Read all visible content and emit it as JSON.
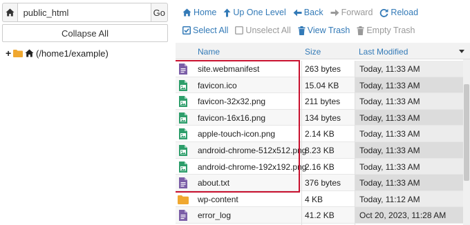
{
  "left_pane": {
    "path_value": "public_html",
    "go_label": "Go",
    "collapse_label": "Collapse All",
    "tree_root_label": "(/home1/example)"
  },
  "toolbar": {
    "row1": [
      {
        "label": "Home",
        "icon": "home-icon",
        "enabled": true
      },
      {
        "label": "Up One Level",
        "icon": "arrow-up-icon",
        "enabled": true
      },
      {
        "label": "Back",
        "icon": "arrow-left-icon",
        "enabled": true
      },
      {
        "label": "Forward",
        "icon": "arrow-right-icon",
        "enabled": false
      },
      {
        "label": "Reload",
        "icon": "reload-icon",
        "enabled": true
      }
    ],
    "row2": [
      {
        "label": "Select All",
        "icon": "checkbox-checked-icon",
        "enabled": true
      },
      {
        "label": "Unselect All",
        "icon": "checkbox-empty-icon",
        "enabled": false
      },
      {
        "label": "View Trash",
        "icon": "trash-icon",
        "enabled": true
      },
      {
        "label": "Empty Trash",
        "icon": "trash-icon",
        "enabled": false
      }
    ]
  },
  "table": {
    "headers": {
      "name": "Name",
      "size": "Size",
      "modified": "Last Modified"
    },
    "rows": [
      {
        "name": "site.webmanifest",
        "size": "263 bytes",
        "modified": "Today, 11:33 AM",
        "type": "text"
      },
      {
        "name": "favicon.ico",
        "size": "15.04 KB",
        "modified": "Today, 11:33 AM",
        "type": "image"
      },
      {
        "name": "favicon-32x32.png",
        "size": "211 bytes",
        "modified": "Today, 11:33 AM",
        "type": "image"
      },
      {
        "name": "favicon-16x16.png",
        "size": "134 bytes",
        "modified": "Today, 11:33 AM",
        "type": "image"
      },
      {
        "name": "apple-touch-icon.png",
        "size": "2.14 KB",
        "modified": "Today, 11:33 AM",
        "type": "image"
      },
      {
        "name": "android-chrome-512x512.png",
        "size": "8.23 KB",
        "modified": "Today, 11:33 AM",
        "type": "image"
      },
      {
        "name": "android-chrome-192x192.png",
        "size": "2.16 KB",
        "modified": "Today, 11:33 AM",
        "type": "image"
      },
      {
        "name": "about.txt",
        "size": "376 bytes",
        "modified": "Today, 11:33 AM",
        "type": "text"
      },
      {
        "name": "wp-content",
        "size": "4 KB",
        "modified": "Today, 11:12 AM",
        "type": "folder"
      },
      {
        "name": "error_log",
        "size": "41.2 KB",
        "modified": "Oct 20, 2023, 11:28 AM",
        "type": "text"
      }
    ]
  },
  "colors": {
    "link": "#337ab7",
    "disabled": "#999999",
    "highlight_border": "#c8102e",
    "text_file_icon": "#7b5ea7",
    "image_file_icon": "#2e9e6b",
    "folder_icon": "#f0a830"
  }
}
